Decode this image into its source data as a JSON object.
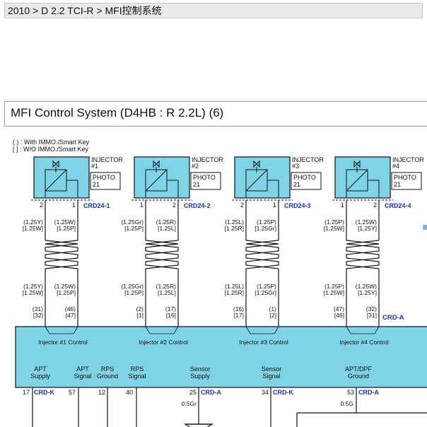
{
  "breadcrumb": "2010 > D 2.2 TCI-R > MFI控制系统",
  "diagram_title": "MFI Control System  (D4HB : R 2.2L) (6)",
  "legend": {
    "paren": "( ) : With IMMO./Smart Key",
    "bracket": "[ ] : W/O IMMO./Smart Key"
  },
  "injectors": [
    {
      "name_line1": "INJECTOR",
      "name_line2": "#1",
      "photo_line1": "PHOTO",
      "photo_line2": "21",
      "pin_left": "2",
      "pin_right": "1",
      "connector": "CRD24-1",
      "wire_left_top": "(1.25Y)",
      "wire_left_bot": "[1.25W]",
      "wire_right_top": "(1.25W)",
      "wire_right_bot": "[1.25P]",
      "wire_left_top2": "(1.25Y)",
      "wire_left_bot2": "[1.25W]",
      "wire_right_top2": "(1.25W)",
      "wire_right_bot2": "[1.25P]",
      "pin2_left_top": "(31)",
      "pin2_left_bot": "[32]",
      "pin2_right_top": "(46)",
      "pin2_right_bot": "[47]",
      "control": "Injector #1 Control"
    },
    {
      "name_line1": "INJECTOR",
      "name_line2": "#2",
      "photo_line1": "PHOTO",
      "photo_line2": "21",
      "pin_left": "1",
      "pin_right": "2",
      "connector": "CRD24-2",
      "wire_left_top": "(1.25Gr)",
      "wire_left_bot": "[1.25P]",
      "wire_right_top": "(1.25R)",
      "wire_right_bot": "[1.25L]",
      "wire_left_top2": "(1.25Gr)",
      "wire_left_bot2": "[1.25P]",
      "wire_right_top2": "(1.25R)",
      "wire_right_bot2": "[1.25L]",
      "pin2_left_top": "(2)",
      "pin2_left_bot": "[1]",
      "pin2_right_top": "(17)",
      "pin2_right_bot": "[16]",
      "control": "Injector #2 Control"
    },
    {
      "name_line1": "INJECTOR",
      "name_line2": "#3",
      "photo_line1": "PHOTO",
      "photo_line2": "21",
      "pin_left": "2",
      "pin_right": "1",
      "connector": "CRD24-3",
      "wire_left_top": "(1.25L)",
      "wire_left_bot": "[1.25R]",
      "wire_right_top": "(1.25P)",
      "wire_right_bot": "[1.25Gr]",
      "wire_left_top2": "(1.25L)",
      "wire_left_bot2": "[1.25R]",
      "wire_right_top2": "(1.25P)",
      "wire_right_bot2": "[1.25Gr]",
      "pin2_left_top": "(16)",
      "pin2_left_bot": "[17]",
      "pin2_right_top": "(1)",
      "pin2_right_bot": "[2]",
      "control": "Injector #3 Control"
    },
    {
      "name_line1": "INJECTOR",
      "name_line2": "#4",
      "photo_line1": "PHOTO",
      "photo_line2": "21",
      "pin_left": "1",
      "pin_right": "2",
      "connector": "CRD24-4",
      "wire_left_top": "(1.25P)",
      "wire_left_bot": "[1.25W]",
      "wire_right_top": "(1.25W)",
      "wire_right_bot": "[1.25Y]",
      "wire_left_top2": "(1.25P)",
      "wire_left_bot2": "[1.25W]",
      "wire_right_top2": "(1.25W)",
      "wire_right_bot2": "[1.25Y]",
      "pin2_left_top": "(47)",
      "pin2_left_bot": "[46]",
      "pin2_right_top": "(32)",
      "pin2_right_bot": "[31]",
      "control": "Injector #4 Control"
    }
  ],
  "ecm_connector": "CRD-A",
  "signals": [
    {
      "line1": "APT",
      "line2": "Supply"
    },
    {
      "line1": "APT",
      "line2": "Signal"
    },
    {
      "line1": "RPS",
      "line2": "Ground"
    },
    {
      "line1": "RPS",
      "line2": "Signal"
    },
    {
      "line1": "Sensor",
      "line2": "Supply"
    },
    {
      "line1": "Sensor",
      "line2": "Signal"
    },
    {
      "line1": "APT/DPF",
      "line2": "Ground"
    }
  ],
  "bottom_pins": {
    "p17": "17",
    "p17_conn": "CRD-K",
    "p57": "57",
    "p12": "12",
    "p40": "40",
    "p25": "25",
    "p25_conn": "CRD-A",
    "p25_wire": "0.5Gr",
    "p34": "34",
    "p34_conn": "CRD-K",
    "p53": "53",
    "p53_conn": "CRD-A",
    "p53_wire": "0.5G"
  },
  "colors": {
    "component_fill": "#7fd3e6",
    "connector_text": "#1a2fc7",
    "wire": "#111111"
  }
}
